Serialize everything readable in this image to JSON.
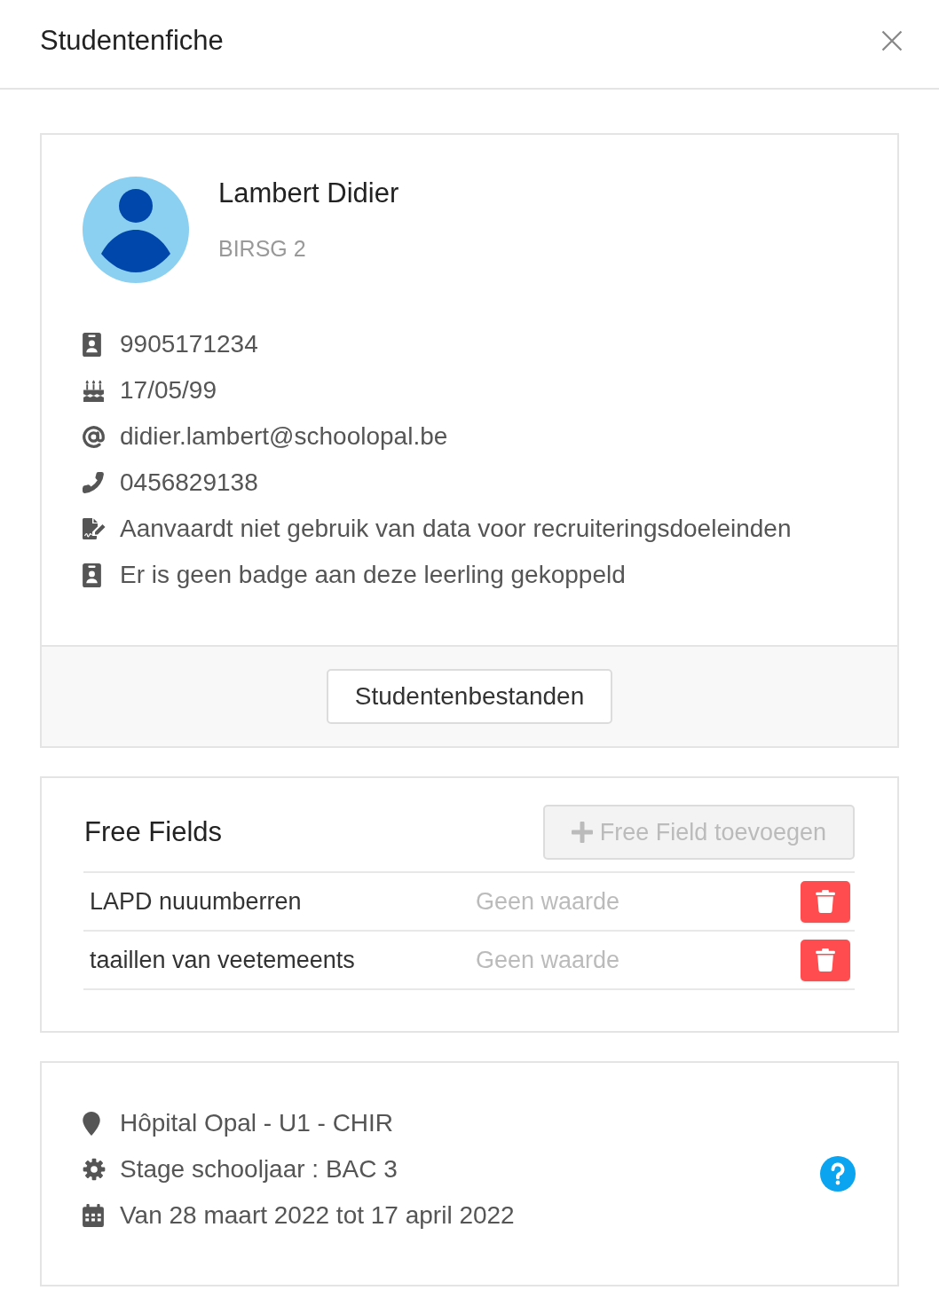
{
  "dialog": {
    "title": "Studentenfiche"
  },
  "profile": {
    "name": "Lambert Didier",
    "class": "BIRSG 2",
    "details": [
      {
        "kind": "idcard",
        "text": "9905171234"
      },
      {
        "kind": "cake",
        "text": "17/05/99"
      },
      {
        "kind": "at",
        "text": "didier.lambert@schoolopal.be"
      },
      {
        "kind": "phone",
        "text": "0456829138"
      },
      {
        "kind": "signature",
        "text": "Aanvaardt niet gebruik van data voor recruiteringsdoeleinden"
      },
      {
        "kind": "idcard",
        "text": "Er is geen badge aan deze leerling gekoppeld"
      }
    ],
    "files_button": "Studentenbestanden"
  },
  "free_fields": {
    "title": "Free Fields",
    "add_button": {
      "label": "Free Field toevoegen",
      "disabled": true
    },
    "rows": [
      {
        "name": "LAPD nuuumberren",
        "value": "Geen waarde"
      },
      {
        "name": "taaillen van veetemeents",
        "value": "Geen waarde"
      }
    ]
  },
  "internship": {
    "details": [
      {
        "kind": "marker",
        "text": "Hôpital Opal - U1 - CHIR"
      },
      {
        "kind": "gear",
        "text": "Stage schooljaar : BAC 3"
      },
      {
        "kind": "calendar",
        "text": "Van 28 maart 2022 tot 17 april 2022"
      }
    ]
  }
}
